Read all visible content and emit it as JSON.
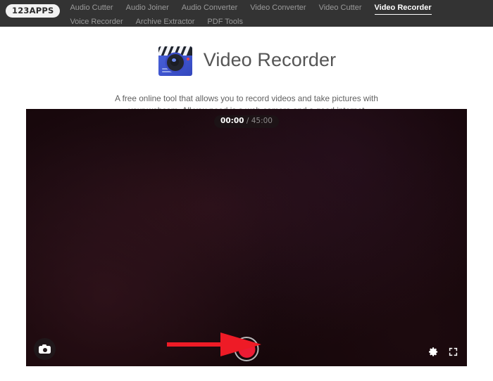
{
  "nav": {
    "logo": "123APPS",
    "items": [
      {
        "label": "Audio Cutter",
        "active": false
      },
      {
        "label": "Audio Joiner",
        "active": false
      },
      {
        "label": "Audio Converter",
        "active": false
      },
      {
        "label": "Video Converter",
        "active": false
      },
      {
        "label": "Video Cutter",
        "active": false
      },
      {
        "label": "Video Recorder",
        "active": true
      },
      {
        "label": "Voice Recorder",
        "active": false
      },
      {
        "label": "Archive Extractor",
        "active": false
      },
      {
        "label": "PDF Tools",
        "active": false
      }
    ]
  },
  "header": {
    "icon_name": "video-recorder-app-icon",
    "title": "Video Recorder",
    "description": "A free online tool that allows you to record videos and take pictures with your webcam. All you need is a web camera and a good internet connection."
  },
  "player": {
    "timer": {
      "current": "00:00",
      "separator": "/",
      "total": "45:00"
    },
    "controls": {
      "photo_icon": "camera-icon",
      "record_icon": "record-button",
      "settings_icon": "gear-icon",
      "fullscreen_icon": "fullscreen-icon"
    },
    "annotation": {
      "type": "arrow",
      "points_to": "record-button",
      "color": "#ee1b26"
    }
  },
  "colors": {
    "navbar_bg": "#333333",
    "page_bg": "#ffffff",
    "title_text": "#555555",
    "body_text": "#5f5f5f",
    "nav_inactive": "#9a9a9a",
    "nav_active": "#ffffff",
    "record_red": "#ed1b34",
    "arrow_red": "#ee1b26",
    "video_bg": "#1d0b11",
    "app_icon_blue": "#3f55cf"
  }
}
